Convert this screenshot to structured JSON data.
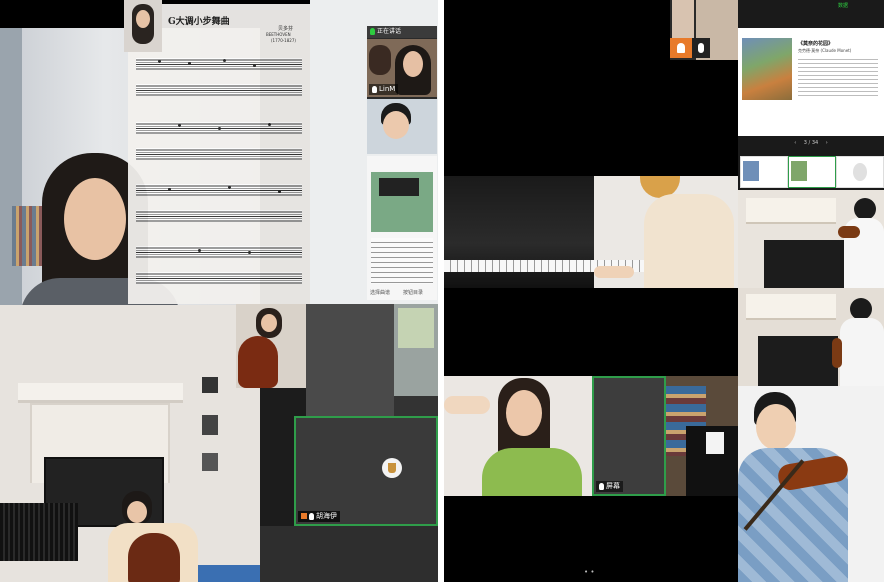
{
  "left_panel": {
    "sheet_music": {
      "title": "G大调小步舞曲",
      "composer": "贝多芬",
      "composer_en": "BEETHOVEN",
      "years": "(1770-1827)"
    },
    "speaker_panel": {
      "header": "正在讲话",
      "participant_name": "LinM"
    },
    "thumb_footer": {
      "left": "选择曲谱",
      "right": "按钮目录"
    },
    "bottom_participant_name": "胡海伊",
    "colors": {
      "accent_green": "#2f9d4a",
      "video_bg": "#3a3a3a",
      "mic_green": "#2ecc40"
    }
  },
  "right_panel": {
    "battery_label": "数据",
    "slide": {
      "title": "《莫奈的花园》",
      "subtitle": "克劳德·莫奈 (Claude Monet)",
      "page_indicator": "3 / 34"
    },
    "bottom_participant_name": "屏幕",
    "pagination_dots": "• •",
    "colors": {
      "mic_orange": "#e87a2a",
      "accent_green": "#2f9d4a",
      "tile_bg": "#000000"
    }
  },
  "icons": [
    "microphone-icon",
    "user-icon",
    "prev-page-icon",
    "next-page-icon",
    "cup-icon"
  ]
}
